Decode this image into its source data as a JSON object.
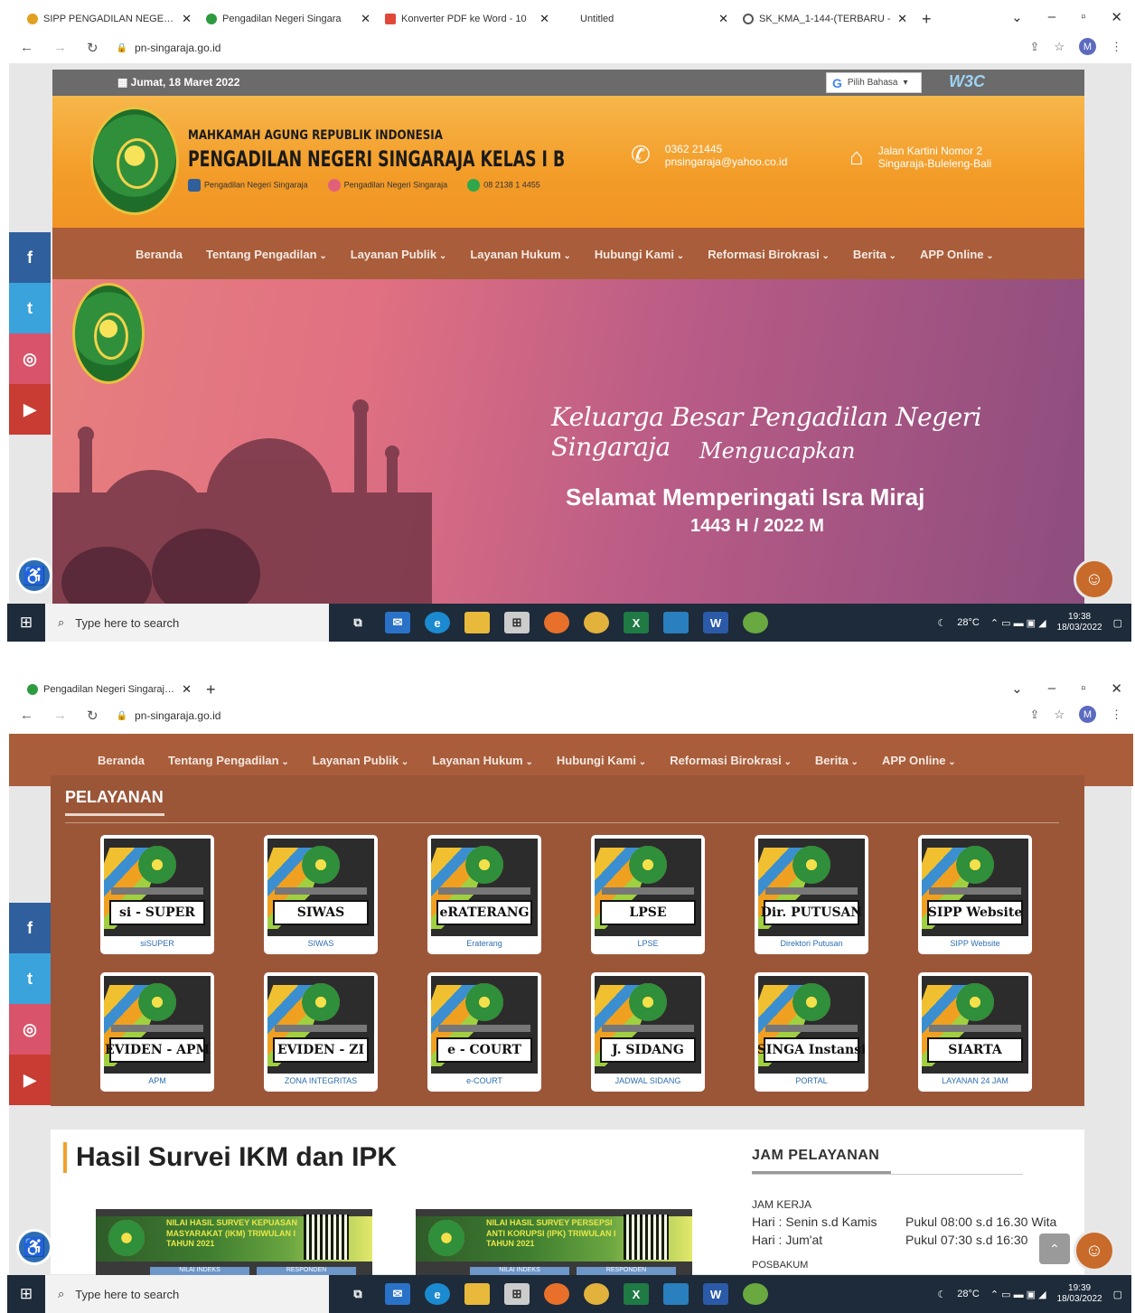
{
  "shot1": {
    "tabs": [
      {
        "title": "SIPP PENGADILAN NEGERI S",
        "color": "#e0a020"
      },
      {
        "title": "Pengadilan Negeri Singara",
        "color": "#2e9a3f"
      },
      {
        "title": "Konverter PDF ke Word - 10",
        "color": "#e0483a"
      },
      {
        "title": "Untitled",
        "color": "#ffffff"
      },
      {
        "title": "SK_KMA_1-144-(TERBARU -",
        "color": "#555555"
      }
    ],
    "url": "pn-singaraja.go.id",
    "date": "Jumat, 18 Maret 2022",
    "lang_label": "Pilih Bahasa",
    "w3c": "W3C",
    "org_line1": "MAHKAMAH AGUNG REPUBLIK INDONESIA",
    "org_line2": "PENGADILAN NEGERI SINGARAJA KELAS I B",
    "links": [
      "Pengadilan Negeri Singaraja",
      "Pengadilan Negeri Singaraja",
      "08 2138 1 4455"
    ],
    "phone": "0362 21445",
    "email": "pnsingaraja@yahoo.co.id",
    "address1": "Jalan Kartini Nomor 2",
    "address2": "Singaraja-Buleleng-Bali",
    "banner": {
      "script1": "Keluarga Besar Pengadilan Negeri Singaraja",
      "script2": "Mengucapkan",
      "greeting": "Selamat Memperingati Isra Miraj",
      "year": "1443 H / 2022 M"
    },
    "taskbar": {
      "search": "Type here to search",
      "temp": "28°C",
      "time": "19:38",
      "date": "18/03/2022"
    }
  },
  "menu": [
    "Beranda",
    "Tentang Pengadilan",
    "Layanan Publik",
    "Layanan Hukum",
    "Hubungi Kami",
    "Reformasi Birokrasi",
    "Berita",
    "APP Online"
  ],
  "shot2": {
    "tab": "Pengadilan Negeri Singaraja Ke",
    "url": "pn-singaraja.go.id",
    "pelayanan_title": "PELAYANAN",
    "services": [
      {
        "label": "si - SUPER",
        "caption": "siSUPER"
      },
      {
        "label": "SIWAS",
        "caption": "SIWAS"
      },
      {
        "label": "eRATERANG",
        "caption": "Eraterang"
      },
      {
        "label": "LPSE",
        "caption": "LPSE"
      },
      {
        "label": "Dir. PUTUSAN",
        "caption": "Direktori Putusan"
      },
      {
        "label": "SIPP Website",
        "caption": "SIPP Website"
      },
      {
        "label": "EVIDEN - APM",
        "caption": "APM"
      },
      {
        "label": "EVIDEN - ZI",
        "caption": "ZONA INTEGRITAS"
      },
      {
        "label": "e - COURT",
        "caption": "e-COURT"
      },
      {
        "label": "J. SIDANG",
        "caption": "JADWAL SIDANG"
      },
      {
        "label": "SINGA Instansi",
        "caption": "PORTAL"
      },
      {
        "label": "SIARTA",
        "caption": "LAYANAN 24 JAM"
      }
    ],
    "survey_title": "Hasil Survei IKM dan IPK",
    "survey_imgs": [
      {
        "title": "NILAI HASIL SURVEY KEPUASAN MASYARAKAT (IKM) TRIWULAN I TAHUN 2021",
        "btn1": "NILAI INDEKS",
        "btn2": "RESPONDEN"
      },
      {
        "title": "NILAI HASIL SURVEY PERSEPSI ANTI KORUPSI (IPK) TRIWULAN I TAHUN 2021",
        "btn1": "NILAI INDEKS",
        "btn2": "RESPONDEN"
      }
    ],
    "jam": {
      "title": "JAM PELAYANAN",
      "kerja": "JAM KERJA",
      "row1_day": "Hari : Senin s.d Kamis",
      "row1_time": "Pukul 08:00 s.d 16.30 Wita",
      "row2_day": "Hari : Jum'at",
      "row2_time": "Pukul 07:30 s.d 16:30",
      "pos": "POSBAKUM"
    },
    "taskbar": {
      "search": "Type here to search",
      "temp": "28°C",
      "time": "19:39",
      "date": "18/03/2022"
    }
  }
}
